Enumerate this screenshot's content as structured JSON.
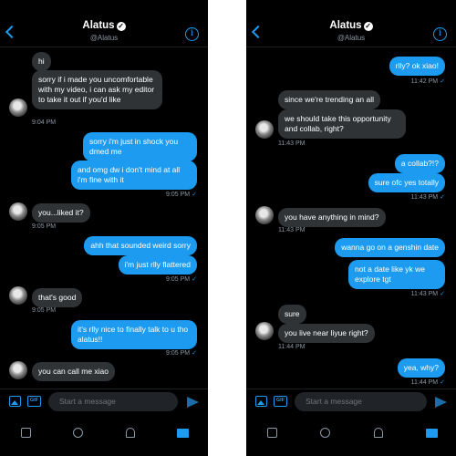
{
  "header": {
    "name": "Alatus",
    "handle": "@Alatus",
    "info_glyph": "i",
    "verified_glyph": "✓"
  },
  "composer": {
    "placeholder": "Start a message",
    "gif_label": "GIF"
  },
  "left": {
    "messages": [
      {
        "dir": "in",
        "text": "hi"
      },
      {
        "dir": "in",
        "text": "sorry if i made you uncomfortable with my video, i can ask my editor to take it out if you'd like"
      },
      {
        "dir": "out",
        "text": "sorry i'm just in shock you dmed me"
      },
      {
        "dir": "out",
        "text": "and omg dw i don't mind at all i'm fine with it"
      },
      {
        "dir": "in",
        "text": "you...liked it?"
      },
      {
        "dir": "out",
        "text": "ahh that sounded weird sorry"
      },
      {
        "dir": "out",
        "text": "i'm just rlly flattered"
      },
      {
        "dir": "in",
        "text": "that's good"
      },
      {
        "dir": "out",
        "text": "it's rlly nice to finally talk to u tho alatus!!"
      },
      {
        "dir": "in",
        "text": "you can call me xiao"
      }
    ],
    "timestamps": [
      "9:04 PM",
      "9:05 PM",
      "9:05 PM",
      "9:05 PM",
      "9:05 PM",
      "9:05 PM"
    ]
  },
  "right": {
    "messages": [
      {
        "dir": "out",
        "text": "rlly? ok xiao!"
      },
      {
        "dir": "in",
        "text": "since we're trending an all"
      },
      {
        "dir": "in",
        "text": "we should take this opportunity and collab, right?"
      },
      {
        "dir": "out",
        "text": "a collab?!?"
      },
      {
        "dir": "out",
        "text": "sure ofc yes totally"
      },
      {
        "dir": "in",
        "text": "you have anything in mind?"
      },
      {
        "dir": "out",
        "text": "wanna go on a genshin date"
      },
      {
        "dir": "out",
        "text": "not a date like yk we explore tgt"
      },
      {
        "dir": "in",
        "text": "sure"
      },
      {
        "dir": "in",
        "text": "you live near liyue right?"
      },
      {
        "dir": "out",
        "text": "yea, why?"
      }
    ],
    "timestamps": [
      "11:42 PM",
      "11:43 PM",
      "11:43 PM",
      "11:43 PM",
      "11:43 PM",
      "11:44 PM",
      "11:44 PM"
    ]
  },
  "check_glyph": "✓",
  "icons": [
    "home-icon",
    "search-icon",
    "bell-icon",
    "mail-icon",
    "image-icon",
    "gif-icon",
    "send-icon",
    "info-icon",
    "back-icon",
    "verified-icon"
  ],
  "colors": {
    "accent": "#1d9bf0",
    "incoming_bubble": "#2f3336",
    "background": "#000000"
  }
}
